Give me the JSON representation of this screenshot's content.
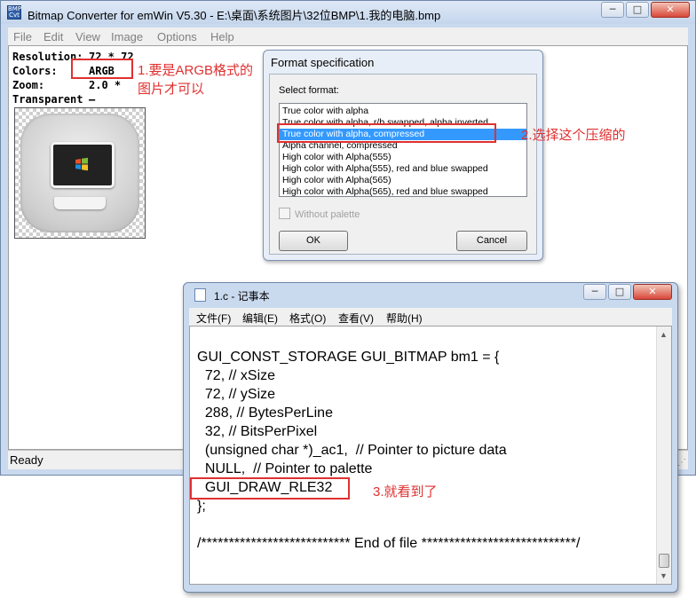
{
  "main_window": {
    "title": "Bitmap Converter for emWin V5.30 - E:\\桌面\\系统图片\\32位BMP\\1.我的电脑.bmp",
    "icon_text": "BMP Cvt",
    "caption_buttons": {
      "minimize": "─",
      "maximize": "□",
      "close": "✕"
    },
    "menu": [
      "File",
      "Edit",
      "View",
      "Image",
      "Options",
      "Help"
    ],
    "info": {
      "resolution_label": "Resolution:",
      "resolution_value": "72 * 72",
      "colors_label": "Colors:",
      "colors_value": "ARGB",
      "zoom_label": "Zoom:",
      "zoom_value": "2.0 *",
      "transparent_label": "Transparent",
      "transparent_value": "—"
    },
    "status": "Ready"
  },
  "dialog": {
    "title": "Format specification",
    "select_label": "Select format:",
    "options": [
      "True color with alpha",
      "True color with alpha, r/b swapped, alpha inverted",
      "True color with alpha, compressed",
      "Alpha channel, compressed",
      "High color with Alpha(555)",
      "High color with Alpha(555), red and blue swapped",
      "High color with Alpha(565)",
      "High color with Alpha(565), red and blue swapped"
    ],
    "selected_index": 2,
    "without_palette": "Without palette",
    "ok": "OK",
    "cancel": "Cancel"
  },
  "notepad": {
    "title": "1.c - 记事本",
    "caption_buttons": {
      "minimize": "─",
      "maximize": "□",
      "close": "✕"
    },
    "menu": [
      "文件(F)",
      "编辑(E)",
      "格式(O)",
      "查看(V)",
      "帮助(H)"
    ],
    "lines": [
      "GUI_CONST_STORAGE GUI_BITMAP bm1 = {",
      "  72, // xSize",
      "  72, // ySize",
      "  288, // BytesPerLine",
      "  32, // BitsPerPixel",
      "  (unsigned char *)_ac1,  // Pointer to picture data",
      "  NULL,  // Pointer to palette",
      "  GUI_DRAW_RLE32",
      "};",
      "",
      "/*************************** End of file ****************************/"
    ]
  },
  "annotations": {
    "note1_line1": "1.要是ARGB格式的",
    "note1_line2": "图片才可以",
    "note2": "2.选择这个压缩的",
    "note3": "3.就看到了",
    "color": "#e03030"
  },
  "icons": [
    "app-icon",
    "windows-logo-icon",
    "monitor-icon",
    "notepad-icon"
  ]
}
